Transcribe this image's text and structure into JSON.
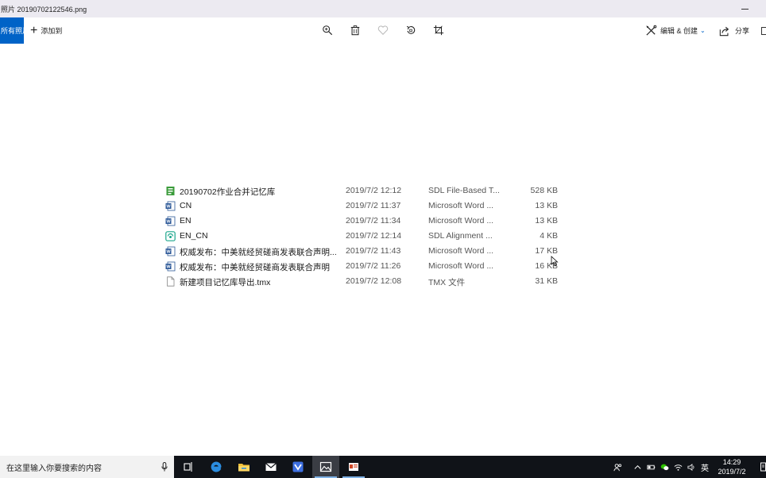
{
  "window": {
    "title": "照片 20190702122546.png"
  },
  "toolbar": {
    "all_photos_label": "所有照片",
    "add_to_label": "添加到",
    "edit_create_label": "编辑 & 创建",
    "share_label": "分享",
    "icons": [
      "zoom-icon",
      "delete-icon",
      "heart-icon",
      "rotate-icon",
      "crop-icon"
    ]
  },
  "files": [
    {
      "name": "20190702作业合并记忆库",
      "date": "2019/7/2 12:12",
      "type": "SDL File-Based T...",
      "size": "528 KB",
      "icon": "sdl-tm-icon"
    },
    {
      "name": "CN",
      "date": "2019/7/2 11:37",
      "type": "Microsoft Word ...",
      "size": "13 KB",
      "icon": "word-icon"
    },
    {
      "name": "EN",
      "date": "2019/7/2 11:34",
      "type": "Microsoft Word ...",
      "size": "13 KB",
      "icon": "word-icon"
    },
    {
      "name": "EN_CN",
      "date": "2019/7/2 12:14",
      "type": "SDL Alignment ...",
      "size": "4 KB",
      "icon": "sdl-alignment-icon"
    },
    {
      "name": "权威发布：中美就经贸磋商发表联合声明...",
      "date": "2019/7/2 11:43",
      "type": "Microsoft Word ...",
      "size": "17 KB",
      "icon": "word-icon"
    },
    {
      "name": "权威发布：中美就经贸磋商发表联合声明",
      "date": "2019/7/2 11:26",
      "type": "Microsoft Word ...",
      "size": "16 KB",
      "icon": "word-icon"
    },
    {
      "name": "新建项目记忆库导出.tmx",
      "date": "2019/7/2 12:08",
      "type": "TMX 文件",
      "size": "31 KB",
      "icon": "blank-file-icon"
    }
  ],
  "taskbar": {
    "search_placeholder": "在这里输入你要搜索的内容",
    "ime_label": "英",
    "time": "14:29",
    "date": "2019/7/2"
  }
}
